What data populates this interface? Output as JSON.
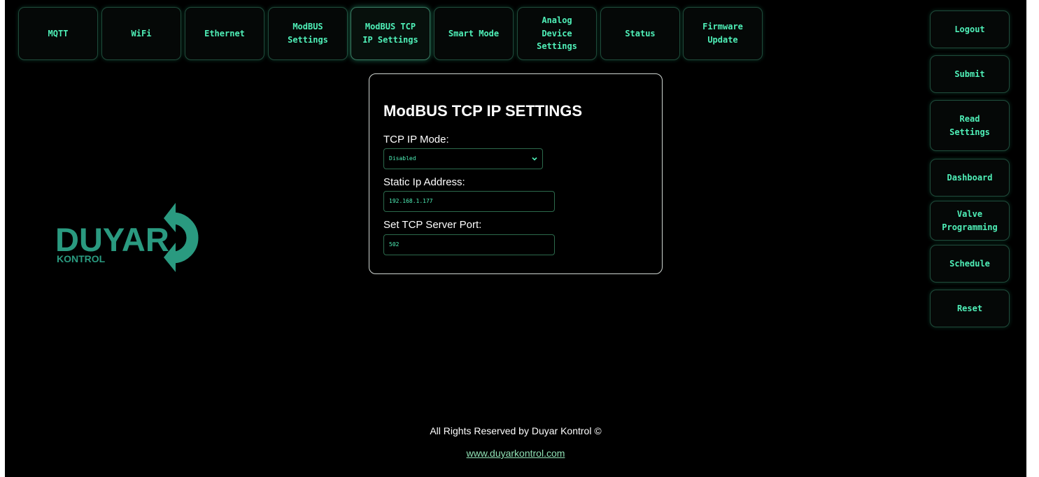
{
  "nav": {
    "tabs": [
      {
        "label": "MQTT"
      },
      {
        "label": "WiFi"
      },
      {
        "label": "Ethernet"
      },
      {
        "label": "ModBUS\nSettings"
      },
      {
        "label": "ModBUS TCP\nIP Settings",
        "active": true
      },
      {
        "label": "Smart Mode"
      },
      {
        "label": "Analog\nDevice\nSettings"
      },
      {
        "label": "Status"
      },
      {
        "label": "Firmware\nUpdate"
      }
    ]
  },
  "side": {
    "buttons": [
      {
        "label": "Logout"
      },
      {
        "label": "Submit"
      },
      {
        "label": "Read\nSettings"
      },
      {
        "label": "Dashboard"
      },
      {
        "label": "Valve\nProgramming"
      },
      {
        "label": "Schedule"
      },
      {
        "label": "Reset"
      }
    ]
  },
  "logo": {
    "brand": "DUYAR",
    "sub": "KONTROL"
  },
  "form": {
    "title": "ModBUS TCP IP SETTINGS",
    "mode_label": "TCP IP Mode:",
    "mode_value": "Disabled",
    "ip_label": "Static Ip Address:",
    "ip_value": "192.168.1.177",
    "port_label": "Set TCP Server Port:",
    "port_value": "502"
  },
  "footer": {
    "text": "All Rights Reserved by Duyar Kontrol ©",
    "link": "www.duyarkontrol.com"
  },
  "colors": {
    "accent": "#4ff0b8",
    "logo_teal": "#2a9a80",
    "background": "#000000"
  }
}
